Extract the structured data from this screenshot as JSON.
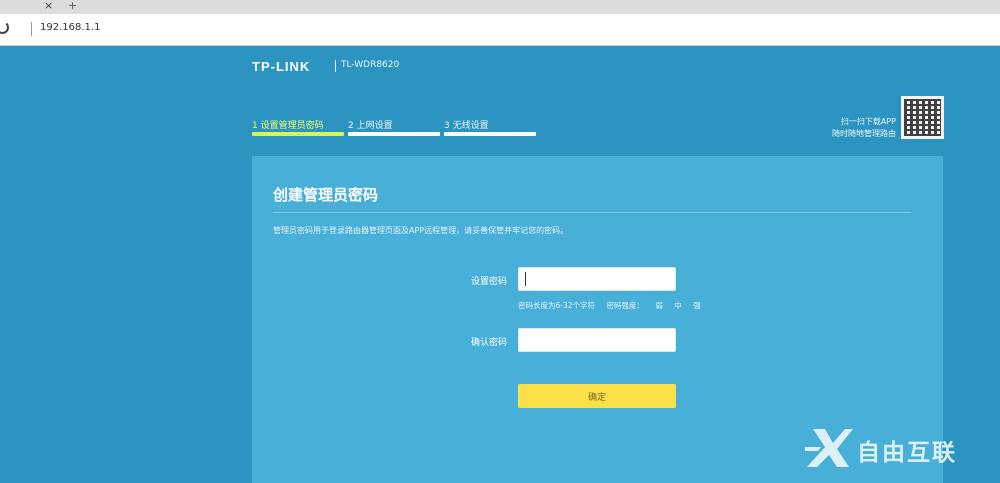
{
  "browser": {
    "tab_close_glyph": "×",
    "tab_new_glyph": "+",
    "url": "192.168.1.1"
  },
  "router": {
    "brand": "TP-LINK",
    "model": "TL-WDR8620",
    "steps": [
      {
        "label": "1 设置管理员密码",
        "active": true
      },
      {
        "label": "2 上网设置",
        "active": false
      },
      {
        "label": "3 无线设置",
        "active": false
      }
    ],
    "qr_text": [
      "扫一扫下载APP",
      "随时随地管理路由"
    ],
    "panel": {
      "title": "创建管理员密码",
      "description": "管理员密码用于登录路由器管理页面及APP远程管理，请妥善保管并牢记您的密码。",
      "password_label": "设置密码",
      "password_hint": [
        "密码长度为6-32个字符",
        "密码强度：",
        "弱",
        "中",
        "强"
      ],
      "confirm_label": "确认密码",
      "confirm_button": "确定"
    }
  },
  "watermark": {
    "text": "自由互联"
  },
  "colors": {
    "background": "#2c94c1",
    "panel": "#48afd8",
    "active_step": "#d8f45a",
    "button": "#fce04a"
  }
}
